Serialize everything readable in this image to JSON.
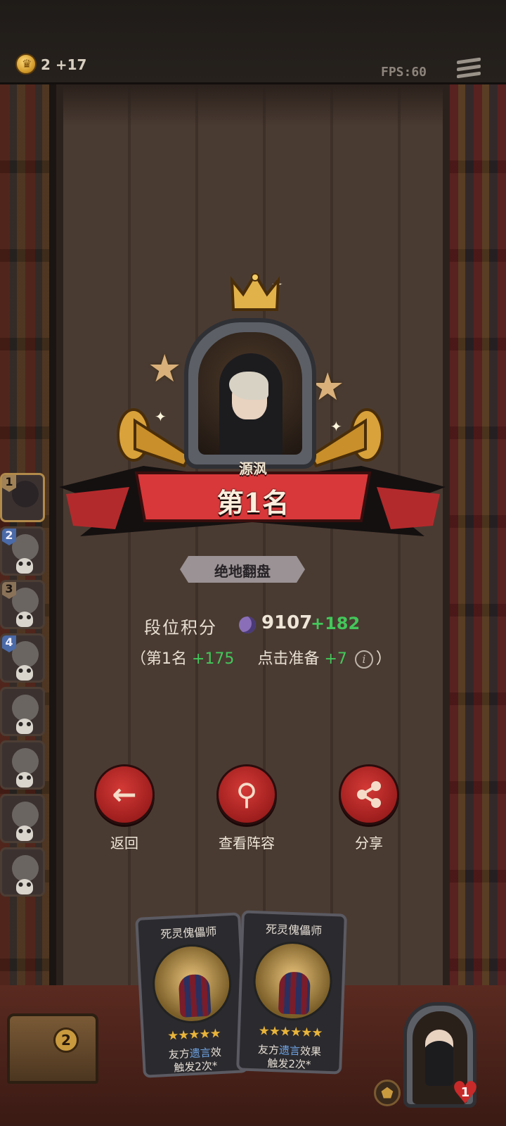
{
  "top_bar": {
    "gold_value": "2 +17",
    "fps_text": "FPS:60"
  },
  "result": {
    "player_name": "源沨",
    "rank_title": "第1名",
    "achievement": "绝地翻盘",
    "score_label": "段位积分",
    "score_value": "9107",
    "score_delta": "+182",
    "detail_open": "（第1名 ",
    "rank_bonus": "+175",
    "ready_label": "点击准备",
    "ready_bonus": "+7",
    "detail_close": "）"
  },
  "actions": {
    "back_label": "返回",
    "view_lineup_label": "查看阵容",
    "share_label": "分享"
  },
  "sidebar": {
    "ranks": [
      "1",
      "2",
      "3",
      "4"
    ]
  },
  "cards": [
    {
      "title": "死灵傀儡师",
      "stars": "★★★★★",
      "desc_pre": "友方",
      "desc_kw": "遗言",
      "desc_post": "效",
      "desc_line2": "触发2次*"
    },
    {
      "title": "死灵傀儡师",
      "stars": "★★★★★★",
      "desc_pre": "友方",
      "desc_kw": "遗言",
      "desc_post": "效果",
      "desc_line2": "触发2次*"
    }
  ],
  "bottom": {
    "chest_count": "2",
    "health": "1"
  },
  "colors": {
    "accent_red": "#c0262a",
    "bonus_green": "#43c75a",
    "keyword_blue": "#6fa6e8"
  }
}
